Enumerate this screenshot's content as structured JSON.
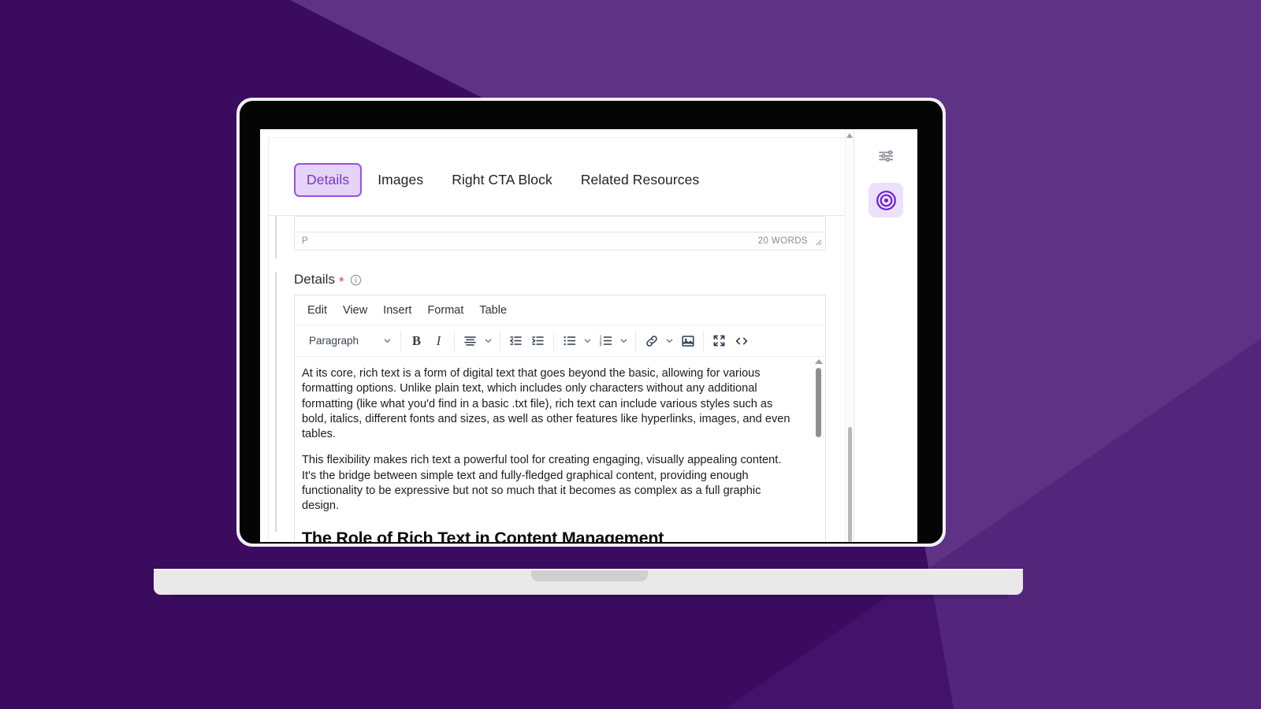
{
  "theme": {
    "bg_dark": "#3B0B60",
    "bg_wedge": "#5E3385",
    "accent_purple": "#6D1FD0",
    "tab_active_bg": "#E5D4F7",
    "tab_active_border": "#9B51E0",
    "tab_active_text": "#7B35C6",
    "required_red": "#E8344A",
    "laptop_bezel": "#050505",
    "laptop_rim": "#F2EFF3",
    "laptop_base": "#E9E9E9"
  },
  "tabs": [
    {
      "label": "Details",
      "active": true,
      "name": "tab-details"
    },
    {
      "label": "Images",
      "active": false,
      "name": "tab-images"
    },
    {
      "label": "Right CTA Block",
      "active": false,
      "name": "tab-right-cta-block"
    },
    {
      "label": "Related Resources",
      "active": false,
      "name": "tab-related-resources"
    }
  ],
  "upper_editor_status": {
    "element_path": "P",
    "word_count": "20 WORDS",
    "resize_grip_icon": "resize-grip-icon"
  },
  "details_field": {
    "label": "Details",
    "required_marker": "*",
    "info_icon": "info-circle-icon"
  },
  "editor": {
    "menubar": [
      {
        "label": "Edit",
        "name": "menu-edit"
      },
      {
        "label": "View",
        "name": "menu-view"
      },
      {
        "label": "Insert",
        "name": "menu-insert"
      },
      {
        "label": "Format",
        "name": "menu-format"
      },
      {
        "label": "Table",
        "name": "menu-table"
      }
    ],
    "toolbar": {
      "block_format_value": "Paragraph",
      "bold_label": "B",
      "italic_label": "I",
      "icons": [
        "block-format-chevron-icon",
        "bold-icon",
        "italic-icon",
        "align-center-icon",
        "align-chevron-icon",
        "outdent-icon",
        "indent-icon",
        "bullet-list-icon",
        "bullet-list-chevron-icon",
        "numbered-list-icon",
        "numbered-list-chevron-icon",
        "link-icon",
        "link-chevron-icon",
        "insert-image-icon",
        "fullscreen-icon",
        "source-code-icon"
      ]
    },
    "content": {
      "paragraphs": [
        "At its core, rich text is a form of digital text that goes beyond the basic, allowing for various formatting options. Unlike plain text, which includes only characters without any additional formatting (like what you'd find in a basic .txt file), rich text can include various styles such as bold, italics, different fonts and sizes, as well as other features like hyperlinks, images, and even tables.",
        "This flexibility makes rich text a powerful tool for creating engaging, visually appealing content. It's the bridge between simple text and fully-fledged graphical content, providing enough functionality to be expressive but not so much that it becomes as complex as a full graphic design."
      ],
      "heading": "The Role of Rich Text in Content Management"
    }
  },
  "right_rail": [
    {
      "name": "rail-settings-button",
      "icon": "sliders-icon",
      "active": false
    },
    {
      "name": "rail-target-button",
      "icon": "target-bullseye-icon",
      "active": true
    }
  ]
}
